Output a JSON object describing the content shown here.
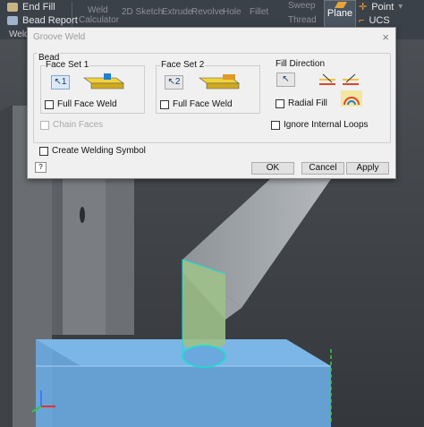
{
  "ribbon": {
    "end_fill": "End Fill",
    "bead_report": "Bead Report",
    "weld_calculator_l1": "Weld",
    "weld_calculator_l2": "Calculator",
    "sketch_2d": "2D Sketch",
    "extrude": "Extrude",
    "revolve": "Revolve",
    "hole": "Hole",
    "fillet": "Fillet",
    "sweep": "Sweep",
    "thread": "Thread",
    "plane": "Plane",
    "point": "Point",
    "ucs": "UCS",
    "panel_weld": "Weld",
    "colors": {
      "ribbon_bg": "#3b4149",
      "accent_orange": "#e8a23a"
    }
  },
  "dialog": {
    "title": "Groove Weld",
    "close_glyph": "×",
    "bead_label": "Bead",
    "face_set_1": {
      "label": "Face Set 1",
      "button": "1",
      "full_face_weld": "Full Face Weld",
      "checked": false
    },
    "face_set_2": {
      "label": "Face Set 2",
      "button": "2",
      "full_face_weld": "Full Face Weld",
      "checked": false
    },
    "fill_direction": {
      "label": "Fill Direction",
      "radial_fill": "Radial Fill",
      "checked": false
    },
    "chain_faces": "Chain Faces",
    "ignore_internal_loops": "Ignore Internal Loops",
    "create_welding_symbol": "Create Welding Symbol",
    "buttons": {
      "ok": "OK",
      "cancel": "Cancel",
      "apply": "Apply"
    },
    "help_glyph": "?"
  },
  "viewport": {
    "colors": {
      "background": "#5a5e63",
      "plate": "#6aa8de",
      "weld_bead": "#9fc08a",
      "cylinder_edge": "#19e0d0"
    }
  }
}
